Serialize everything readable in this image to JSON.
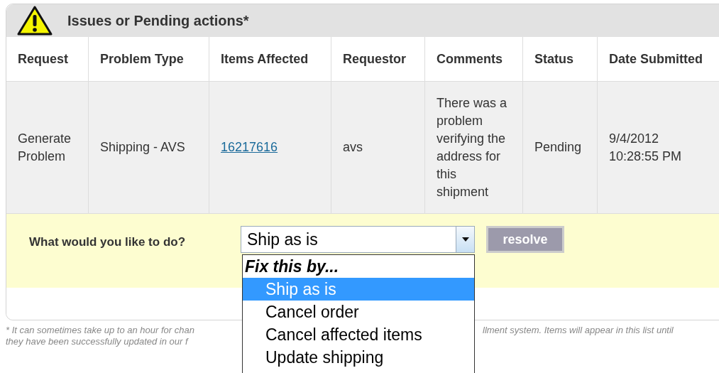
{
  "panel": {
    "title": "Issues or Pending actions*"
  },
  "table": {
    "columns": [
      "Request",
      "Problem Type",
      "Items Affected",
      "Requestor",
      "Comments",
      "Status",
      "Date Submitted"
    ],
    "rows": [
      {
        "request": "Generate Problem",
        "problem_type": "Shipping - AVS",
        "items_affected": "16217616",
        "requestor": "avs",
        "comments": "There was a problem verifying the address for this shipment",
        "status": "Pending",
        "date_submitted": "9/4/2012 10:28:55 PM"
      }
    ]
  },
  "action": {
    "label": "What would you like to do?",
    "select_value": "Ship as is",
    "button": "resolve",
    "dropdown": {
      "group_label": "Fix this by...",
      "options": [
        {
          "label": "Ship as is",
          "selected": true
        },
        {
          "label": "Cancel order",
          "selected": false
        },
        {
          "label": "Cancel affected items",
          "selected": false
        },
        {
          "label": "Update shipping",
          "selected": false
        }
      ]
    }
  },
  "footnote": {
    "left_lines": [
      "* It can sometimes take up to an hour for chan",
      "they have been successfully updated in our f"
    ],
    "right_lines": [
      "llment system. Items will appear in this list until"
    ]
  }
}
